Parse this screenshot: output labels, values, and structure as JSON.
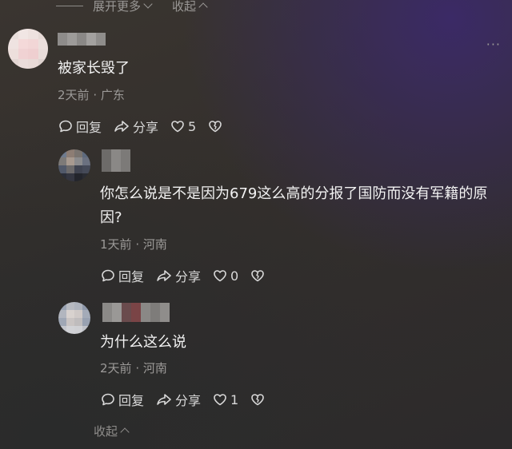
{
  "top": {
    "expand_label": "展开更多",
    "collapse_label": "收起"
  },
  "menu": {
    "more_glyph": "···"
  },
  "comments": [
    {
      "text": "被家长毁了",
      "time": "2天前",
      "location": "广东",
      "reply_label": "回复",
      "share_label": "分享",
      "likes": "5"
    },
    {
      "text": "你怎么说是不是因为679这么高的分报了国防而没有军籍的原因?",
      "time": "1天前",
      "location": "河南",
      "reply_label": "回复",
      "share_label": "分享",
      "likes": "0"
    },
    {
      "text": "为什么这么说",
      "time": "2天前",
      "location": "河南",
      "reply_label": "回复",
      "share_label": "分享",
      "likes": "1"
    }
  ],
  "bottom": {
    "collapse_label": "收起"
  },
  "icons": [
    "reply-icon",
    "share-icon",
    "heart-icon",
    "broken-heart-icon",
    "chevron-down-icon",
    "chevron-up-icon",
    "more-icon"
  ]
}
